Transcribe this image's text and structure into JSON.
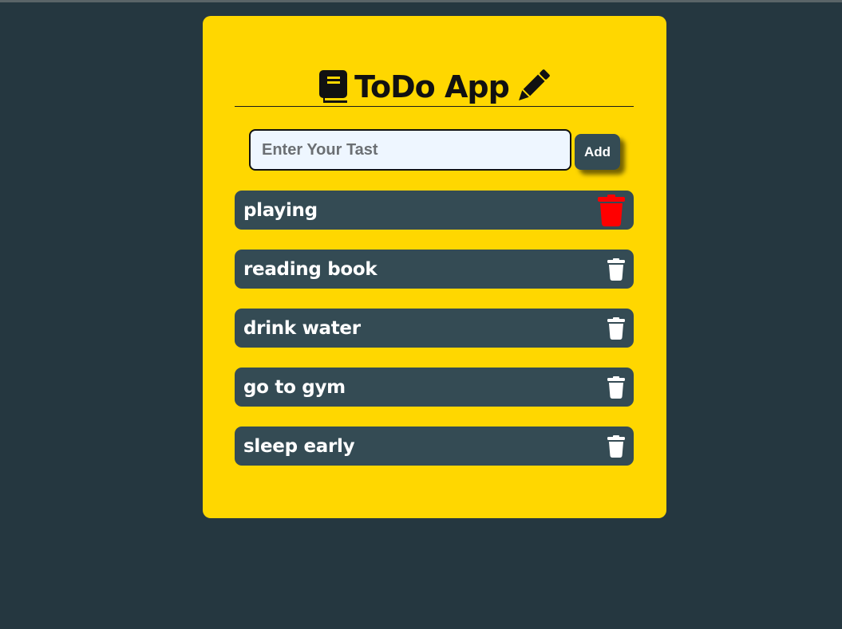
{
  "app": {
    "title": "ToDo App",
    "icons": {
      "left": "book-icon",
      "right": "pencil-icon"
    }
  },
  "input": {
    "placeholder": "Enter Your Tast",
    "value": ""
  },
  "add_button": {
    "label": "Add"
  },
  "tasks": [
    {
      "label": "playing",
      "delete_icon": "trash-icon",
      "hovered": true
    },
    {
      "label": "reading book",
      "delete_icon": "trash-icon",
      "hovered": false
    },
    {
      "label": "drink water",
      "delete_icon": "trash-icon",
      "hovered": false
    },
    {
      "label": "go to gym",
      "delete_icon": "trash-icon",
      "hovered": false
    },
    {
      "label": "sleep early",
      "delete_icon": "trash-icon",
      "hovered": false
    }
  ],
  "colors": {
    "background": "#253740",
    "card": "#FFD700",
    "item": "#344B54",
    "input_bg": "#EEF6FF",
    "delete_hover": "#FF0000",
    "delete_default": "#FFFFFF"
  }
}
